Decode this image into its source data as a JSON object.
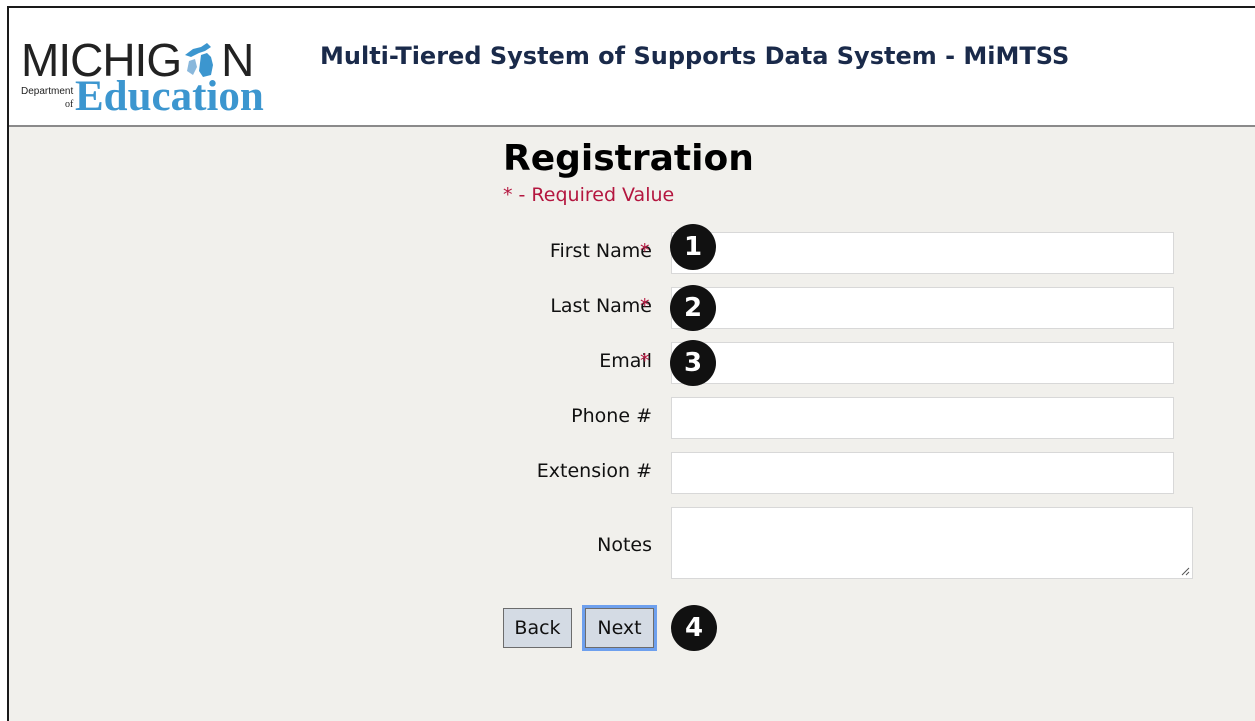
{
  "header": {
    "logo": {
      "word_michigan_left": "MICHIG",
      "word_michigan_right": "N",
      "department": "Department",
      "of": "of",
      "education": "Education"
    },
    "app_title": "Multi-Tiered System of Supports Data System - MiMTSS"
  },
  "form": {
    "title": "Registration",
    "required_note": "* - Required Value",
    "required_mark": "*",
    "fields": [
      {
        "label": "First Name",
        "required": true,
        "value": "",
        "marker": "1"
      },
      {
        "label": "Last Name",
        "required": true,
        "value": "",
        "marker": "2"
      },
      {
        "label": "Email",
        "required": true,
        "value": "",
        "marker": "3"
      },
      {
        "label": "Phone #",
        "required": false,
        "value": ""
      },
      {
        "label": "Extension #",
        "required": false,
        "value": ""
      },
      {
        "label": "Notes",
        "required": false,
        "value": ""
      }
    ],
    "buttons": {
      "back": "Back",
      "next": "Next",
      "next_marker": "4"
    }
  },
  "colors": {
    "required_red": "#b4163f",
    "logo_blue": "#3c96cf",
    "title_navy": "#1a2a4a",
    "focus_ring": "#6ea0ee",
    "page_bg": "#f1f0ec"
  }
}
